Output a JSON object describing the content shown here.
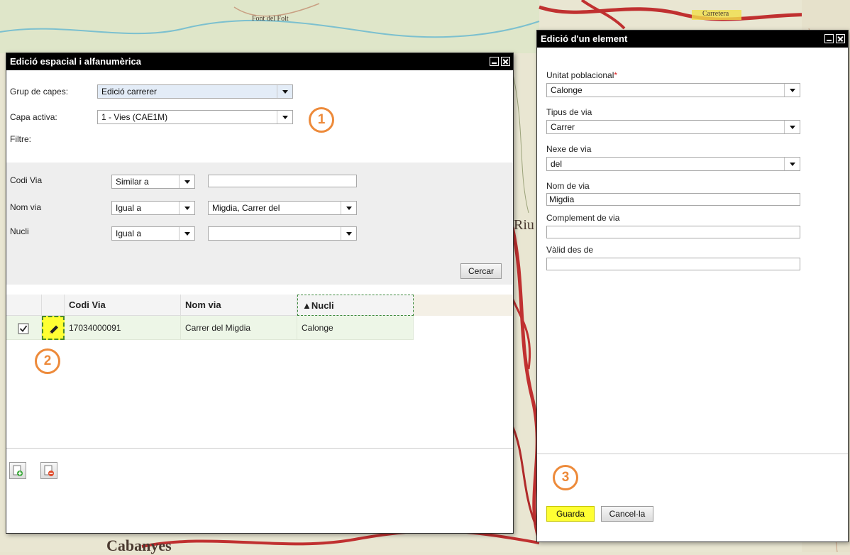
{
  "map": {
    "labels": [
      "Font del Folt",
      "Riu",
      "Cabanyes",
      "Carretera"
    ]
  },
  "left_panel": {
    "title": "Edició espacial i alfanumèrica",
    "group_label": "Grup de capes:",
    "group_value": "Edició carrerer",
    "layer_label": "Capa activa:",
    "layer_value": "1 - Vies (CAE1M)",
    "filter_label": "Filtre:",
    "search": {
      "rows": [
        {
          "label": "Codi Via",
          "operator": "Similar a",
          "value": ""
        },
        {
          "label": "Nom via",
          "operator": "Igual a",
          "value": "Migdia, Carrer del"
        },
        {
          "label": "Nucli",
          "operator": "Igual a",
          "value": ""
        }
      ],
      "search_button": "Cercar"
    },
    "grid": {
      "columns": [
        "Codi Via",
        "Nom via",
        "▲Nucli"
      ],
      "rows": [
        {
          "checked": true,
          "codi_via": "17034000091",
          "nom_via": "Carrer del Migdia",
          "nucli": "Calonge"
        }
      ]
    },
    "footer_icons": [
      "add-record-icon",
      "delete-record-icon"
    ]
  },
  "right_panel": {
    "title": "Edició d'un element",
    "fields": {
      "unitat_label": "Unitat poblacional",
      "required_mark": "*",
      "unitat_value": "Calonge",
      "tipus_label": "Tipus de via",
      "tipus_value": "Carrer",
      "nexe_label": "Nexe de via",
      "nexe_value": "del",
      "nom_label": "Nom de via",
      "nom_value": "Migdia",
      "complement_label": "Complement de via",
      "complement_value": "",
      "valid_label": "Vàlid des de",
      "valid_value": ""
    },
    "save_button": "Guarda",
    "cancel_button": "Cancel·la"
  },
  "callouts": [
    "1",
    "2",
    "3"
  ],
  "colors": {
    "callout": "#ed8a3a",
    "highlight": "#ffff33",
    "titlebar": "#000000",
    "selected_row": "#edf6e7"
  }
}
